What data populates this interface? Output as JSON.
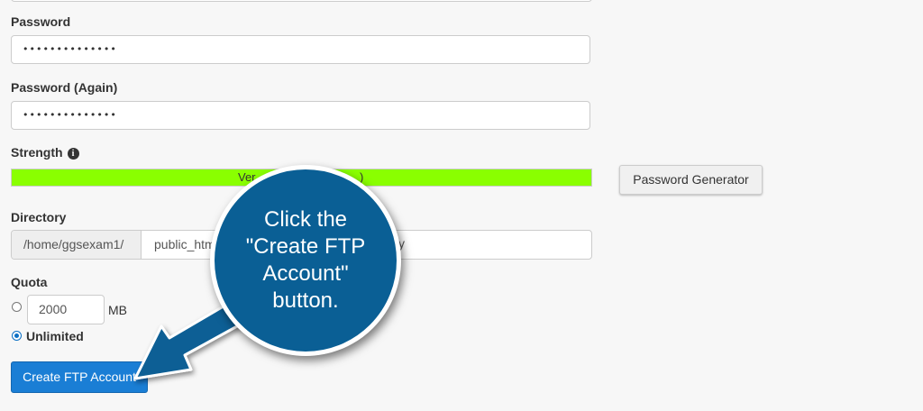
{
  "form": {
    "password_label": "Password",
    "password_value": "••••••••••••••",
    "password_again_label": "Password (Again)",
    "password_again_value": "••••••••••••••",
    "strength_label": "Strength",
    "strength_info_icon": "info-circle-icon",
    "strength_text_left": "Ver",
    "strength_text_right": ")",
    "strength_color": "#8aff00",
    "password_generator_label": "Password Generator",
    "directory_label": "Directory",
    "directory_prefix": "/home/ggsexam1/",
    "directory_value": "public_htm",
    "directory_value_tail": "y",
    "quota_label": "Quota",
    "quota_value": "2000",
    "quota_unit": "MB",
    "quota_unlimited_label": "Unlimited",
    "quota_selected": "Unlimited",
    "create_button_label": "Create FTP Account",
    "create_button_color": "#1a7ed5"
  },
  "annotation": {
    "callout_text": "Click the\n\"Create FTP\nAccount\"\nbutton.",
    "callout_color": "#0a5f95",
    "arrow_icon": "arrow-down-left-icon"
  }
}
